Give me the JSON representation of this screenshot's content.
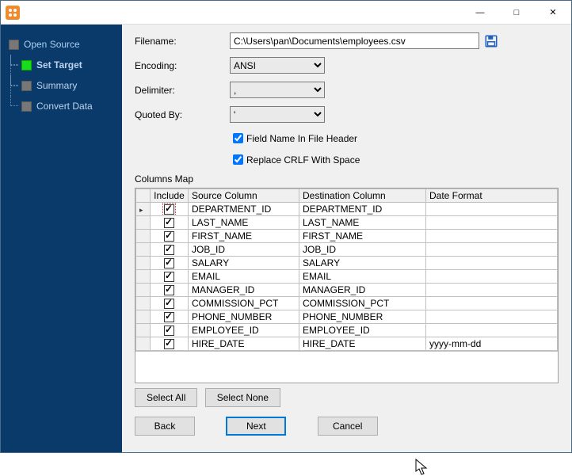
{
  "sidebar": {
    "items": [
      {
        "label": "Open Source"
      },
      {
        "label": "Set Target"
      },
      {
        "label": "Summary"
      },
      {
        "label": "Convert Data"
      }
    ]
  },
  "form": {
    "filename_label": "Filename:",
    "filename_value": "C:\\Users\\pan\\Documents\\employees.csv",
    "encoding_label": "Encoding:",
    "encoding_value": "ANSI",
    "delimiter_label": "Delimiter:",
    "delimiter_value": ",",
    "quoted_label": "Quoted By:",
    "quoted_value": "'",
    "chk_header_label": "Field Name In File Header",
    "chk_crlf_label": "Replace CRLF With Space",
    "columns_map_label": "Columns Map"
  },
  "grid": {
    "headers": {
      "include": "Include",
      "source": "Source Column",
      "dest": "Destination Column",
      "date": "Date Format"
    },
    "rows": [
      {
        "include": true,
        "source": "DEPARTMENT_ID",
        "dest": "DEPARTMENT_ID",
        "date": ""
      },
      {
        "include": true,
        "source": "LAST_NAME",
        "dest": "LAST_NAME",
        "date": ""
      },
      {
        "include": true,
        "source": "FIRST_NAME",
        "dest": "FIRST_NAME",
        "date": ""
      },
      {
        "include": true,
        "source": "JOB_ID",
        "dest": "JOB_ID",
        "date": ""
      },
      {
        "include": true,
        "source": "SALARY",
        "dest": "SALARY",
        "date": ""
      },
      {
        "include": true,
        "source": "EMAIL",
        "dest": "EMAIL",
        "date": ""
      },
      {
        "include": true,
        "source": "MANAGER_ID",
        "dest": "MANAGER_ID",
        "date": ""
      },
      {
        "include": true,
        "source": "COMMISSION_PCT",
        "dest": "COMMISSION_PCT",
        "date": ""
      },
      {
        "include": true,
        "source": "PHONE_NUMBER",
        "dest": "PHONE_NUMBER",
        "date": ""
      },
      {
        "include": true,
        "source": "EMPLOYEE_ID",
        "dest": "EMPLOYEE_ID",
        "date": ""
      },
      {
        "include": true,
        "source": "HIRE_DATE",
        "dest": "HIRE_DATE",
        "date": "yyyy-mm-dd"
      }
    ]
  },
  "buttons": {
    "select_all": "Select All",
    "select_none": "Select None",
    "back": "Back",
    "next": "Next",
    "cancel": "Cancel"
  }
}
